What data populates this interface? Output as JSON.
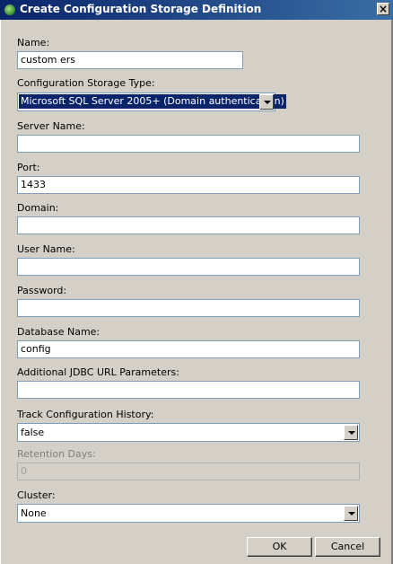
{
  "window": {
    "title": "Create Configuration Storage Definition",
    "close_glyph": "×",
    "icon": "app-icon"
  },
  "form": {
    "name": {
      "label": "Name:",
      "value": "custom ers"
    },
    "storage_type": {
      "label": "Configuration Storage Type:",
      "value": "Microsoft SQL Server 2005+ (Domain authentication)"
    },
    "server_name": {
      "label": "Server Name:",
      "value": ""
    },
    "port": {
      "label": "Port:",
      "value": "1433"
    },
    "domain": {
      "label": "Domain:",
      "value": ""
    },
    "user_name": {
      "label": "User Name:",
      "value": ""
    },
    "password": {
      "label": "Password:",
      "value": ""
    },
    "database_name": {
      "label": "Database Name:",
      "value": "config"
    },
    "jdbc_params": {
      "label": "Additional JDBC URL Parameters:",
      "value": ""
    },
    "track_history": {
      "label": "Track Configuration History:",
      "value": "false"
    },
    "retention_days": {
      "label": "Retention Days:",
      "value": "0"
    },
    "cluster": {
      "label": "Cluster:",
      "value": "None"
    }
  },
  "buttons": {
    "ok": "OK",
    "cancel": "Cancel"
  }
}
